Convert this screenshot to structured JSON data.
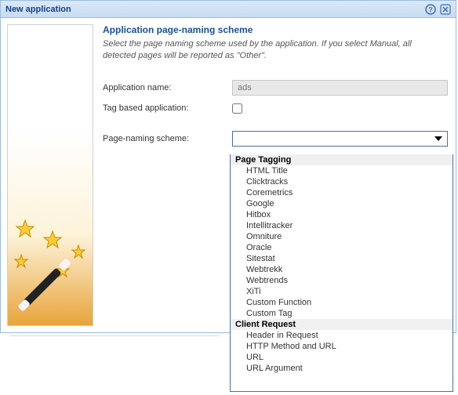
{
  "dialog": {
    "title": "New application"
  },
  "content": {
    "heading": "Application page-naming scheme",
    "subheading": "Select the page naming scheme used by the application. If you select Manual, all detected pages will be reported as \"Other\"."
  },
  "form": {
    "app_name_label": "Application name:",
    "app_name_value": "ads",
    "tag_based_label": "Tag based application:",
    "scheme_label": "Page-naming scheme:"
  },
  "dropdown": {
    "groups": [
      {
        "label": "Page Tagging",
        "items": [
          "HTML Title",
          "Clicktracks",
          "Coremetrics",
          "Google",
          "Hitbox",
          "Intellitracker",
          "Omniture",
          "Oracle",
          "Sitestat",
          "Webtrekk",
          "Webtrends",
          "XiTi",
          "Custom Function",
          "Custom Tag"
        ]
      },
      {
        "label": "Client Request",
        "items": [
          "Header in Request",
          "HTTP Method and URL",
          "URL",
          "URL Argument"
        ]
      }
    ]
  }
}
